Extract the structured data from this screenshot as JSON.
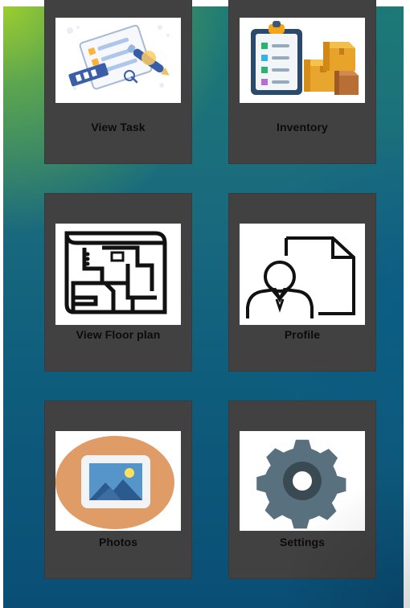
{
  "tiles": [
    {
      "label": "View Task",
      "icon": "task-list-icon"
    },
    {
      "label": "Inventory",
      "icon": "clipboard-boxes-icon"
    },
    {
      "label": "View Floor plan",
      "icon": "floor-plan-icon"
    },
    {
      "label": "Profile",
      "icon": "profile-document-icon"
    },
    {
      "label": "Photos",
      "icon": "photo-gallery-icon"
    },
    {
      "label": "Settings",
      "icon": "settings-gear-icon"
    }
  ],
  "colors": {
    "tile_bg": "#414141",
    "label_text": "#0b0b0b",
    "accent_orange": "#dd9a62",
    "photo_blue": "#4a87b7",
    "gear_gray": "#5c7283",
    "gear_inner": "#38474f"
  }
}
